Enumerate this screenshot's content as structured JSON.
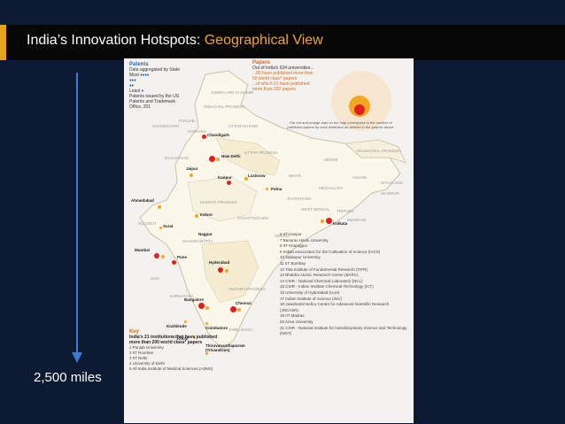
{
  "slide": {
    "title_main": "India’s Innovation  Hotspots: ",
    "title_highlight": "Geographical View",
    "scale_label": "2,500 miles"
  },
  "colors": {
    "background": "#0d1a33",
    "title_bar": "#070707",
    "accent": "#e3a41b",
    "highlight_text": "#f0a52a",
    "arrow": "#3a7bd5"
  },
  "map": {
    "legend_left": {
      "title": "Patents",
      "subtitle": "Data aggregated by State",
      "most": "Most",
      "least": "Least",
      "source": "Patents issued by the US Patents and Trademark Office, 201"
    },
    "legend_right": {
      "title": "Papers",
      "line1": "Out of India's 634 universities...",
      "line2": "...85 have published more than 50 world class* papers",
      "line3": "...of which 21 have published more than 200 papers"
    },
    "legend_note": "The red and orange dots on the map correspond to the number of published papers by each institution as defined in the graphic above",
    "regions": [
      "JAMMU AND KASHMIR",
      "HIMACHAL PRADESH",
      "PUNJAB",
      "CHANDIGARH",
      "UTTARAKHAND",
      "HARYANA",
      "ARUNACHAL PRADESH",
      "UTTAR PRADESH",
      "SIKKIM",
      "ASSAM",
      "NAGALAND",
      "RAJASTHAN",
      "BIHAR",
      "MEGHALAYA",
      "MANIPUR",
      "GUJARAT",
      "MADHYA PRADESH",
      "JHARKHAND",
      "WEST BENGAL",
      "TRIPURA",
      "MIZORAM",
      "CHHATTISGARH",
      "ORISSA",
      "MAHARASHTRA",
      "GOA",
      "ANDHRA PRADESH",
      "KARNATAKA",
      "KERALA",
      "TAMIL NADU"
    ],
    "cities": [
      "Chandigarh",
      "New Delhi",
      "Jaipur",
      "Kanpur",
      "Lucknow",
      "Patna",
      "Ahmedabad",
      "Indore",
      "Kolkata",
      "Surat",
      "Nagpur",
      "Mumbai",
      "Pune",
      "Hyderabad",
      "Bangalore",
      "Chennai",
      "Kozhikode",
      "Coimbatore",
      "Kochi",
      "Thiruvananthapuram (Trivandrum)"
    ],
    "key": {
      "title": "Key",
      "heading": "India's 21 institutions that have published more than 200 world class* papers",
      "items_left": [
        "1 Panjab University",
        "2 IIT Roorkee",
        "3 IIT Delhi",
        "4 University of Delhi",
        "5 All India Institute of Medical Sciences (AIIMS)"
      ],
      "items_right": [
        "6 IIT Kanpur",
        "7 Banaras Hindu University",
        "8 IIT Kharagpur",
        "9 Indian Association for the Cultivation of Science (IACS)",
        "10 Jadavpur University",
        "11 IIT Bombay",
        "12 Tata Institute of Fundamental Research (TIFR)",
        "13 Bhabha Atomic Research Centre (BARC)",
        "14 CSIR - National Chemical Laboratory (NCL)",
        "15 CSIR - Indian Institute Chemical Technology (ICT)",
        "16 University of Hyderabad (UoH)",
        "17 Indian Institute of Science (IISc)",
        "18 Jawaharlal Nehru Centre for Advanced Scientific Research (JNCASR)",
        "19 IIT Madras",
        "20 Anna University",
        "21 CSIR - National Institute for Interdisciplinary Science and Technology (NIST)"
      ]
    }
  }
}
